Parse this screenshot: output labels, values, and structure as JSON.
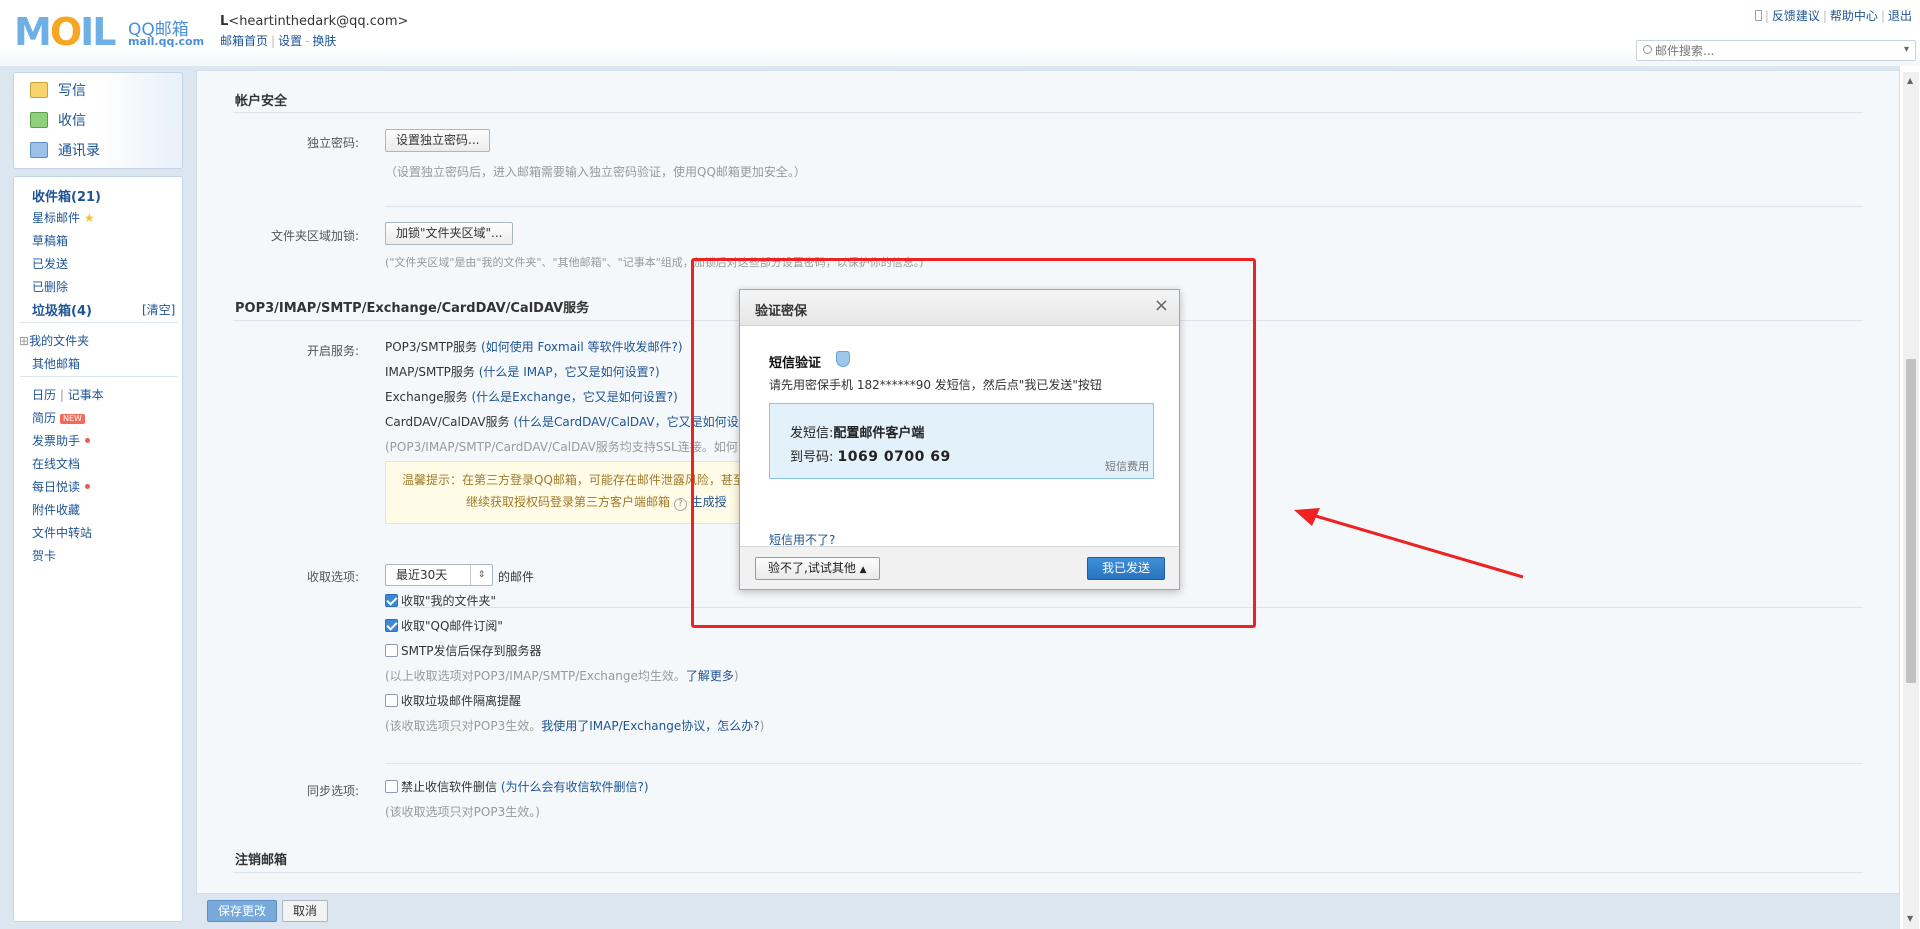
{
  "header": {
    "logo_text": "MOIL",
    "logo_sub1": "QQ邮箱",
    "logo_sub2": "mail.qq.com",
    "account_name": "L",
    "account_email": "<heartinthedark@qq.com>",
    "links": [
      "邮箱首页",
      "设置",
      "换肤"
    ],
    "top_links": [
      "反馈建议",
      "帮助中心",
      "退出"
    ],
    "search_placeholder": "邮件搜索..."
  },
  "sidebar": {
    "tools": [
      "写信",
      "收信",
      "通讯录"
    ],
    "folders": {
      "inbox": "收件箱(21)",
      "starred": "星标邮件",
      "drafts": "草稿箱",
      "sent": "已发送",
      "deleted": "已删除",
      "spam": "垃圾箱(4)",
      "spam_clear": "[清空]",
      "my_folders": "我的文件夹",
      "other": "其他邮箱",
      "calendar": "日历",
      "notes": "记事本",
      "resume": "简历",
      "resume_badge": "NEW",
      "invoice": "发票助手",
      "docs": "在线文档",
      "daily": "每日悦读",
      "attach": "附件收藏",
      "transfer": "文件中转站",
      "card": "贺卡"
    }
  },
  "main": {
    "sec_security": "帐户安全",
    "indep_pwd_label": "独立密码:",
    "indep_pwd_btn": "设置独立密码...",
    "indep_pwd_hint": "（设置独立密码后，进入邮箱需要输入独立密码验证，使用QQ邮箱更加安全。）",
    "folder_lock_label": "文件夹区域加锁:",
    "folder_lock_btn": "加锁\"文件夹区域\"...",
    "folder_lock_hint": "(\"文件夹区域\"是由\"我的文件夹\"、\"其他邮箱\"、\"记事本\"组成，加锁后对这些部分设置密码，以保护你的信息。)",
    "sec_services": "POP3/IMAP/SMTP/Exchange/CardDAV/CalDAV服务",
    "enable_label": "开启服务:",
    "svc_pop3": "POP3/SMTP服务",
    "svc_pop3_link": "(如何使用 Foxmail 等软件收发邮件?)",
    "svc_imap": "IMAP/SMTP服务",
    "svc_imap_link": "(什么是 IMAP，它又是如何设置?)",
    "svc_exchange": "Exchange服务",
    "svc_exchange_link": "(什么是Exchange，它又是如何设置?)",
    "svc_card": "CardDAV/CalDAV服务",
    "svc_card_link": "(什么是CardDAV/CalDAV，它又是如何设",
    "svc_ssl_hint": "(POP3/IMAP/SMTP/CardDAV/CalDAV服务均支持SSL连接。如何",
    "warm_tip1": "温馨提示：在第三方登录QQ邮箱，可能存在邮件泄露风险，甚至",
    "warm_tip2": "继续获取授权码登录第三方客户端邮箱",
    "warm_tip_link": "生成授",
    "recv_label": "收取选项:",
    "recv_select": "最近30天",
    "recv_suffix": "的邮件",
    "opt_myfolder": "收取\"我的文件夹\"",
    "opt_subscribe": "收取\"QQ邮件订阅\"",
    "opt_smtp_save": "SMTP发信后保存到服务器",
    "opt_hint1": "(以上收取选项对POP3/IMAP/SMTP/Exchange均生效。",
    "opt_hint1_link": "了解更多",
    "opt_hint1_end": ")",
    "opt_spam": "收取垃圾邮件隔离提醒",
    "opt_hint2": "(该收取选项只对POP3生效。",
    "opt_hint2_link": "我使用了IMAP/Exchange协议，怎么办?",
    "opt_hint2_end": ")",
    "sync_label": "同步选项:",
    "sync_opt": "禁止收信软件删信",
    "sync_link": "(为什么会有收信软件删信?)",
    "sync_hint": "(该收取选项只对POP3生效。)",
    "sec_cancel": "注销邮箱",
    "save_btn": "保存更改",
    "cancel_btn": "取消"
  },
  "dialog": {
    "title": "验证密保",
    "sms_title": "短信验证",
    "sms_desc": "请先用密保手机 182******90 发短信，然后点\"我已发送\"按钮",
    "send_label": "发短信:",
    "send_value": "配置邮件客户端",
    "to_label": "到号码:",
    "to_value": "1069 0700 69",
    "fee": "短信费用",
    "cant_use": "短信用不了?",
    "try_other": "验不了,试试其他",
    "sent_btn": "我已发送"
  },
  "colors": {
    "accent": "#2a74be",
    "link": "#1e5494",
    "annotation": "#ee2222"
  }
}
